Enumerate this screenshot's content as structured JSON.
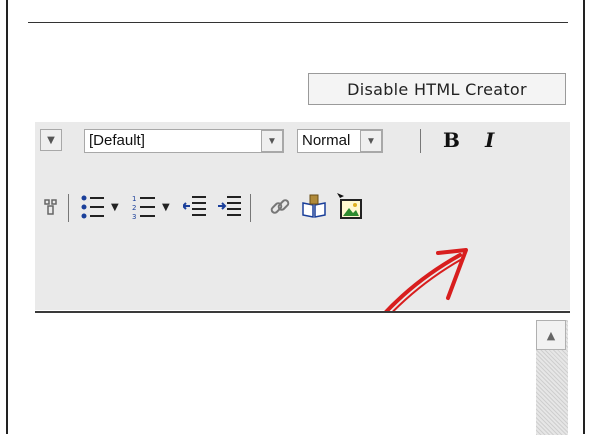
{
  "header": {
    "disable_label": "Disable HTML Creator"
  },
  "toolbar": {
    "font_name_select": {
      "value": "[Default]"
    },
    "format_select": {
      "value": "Normal"
    },
    "bold_label": "B",
    "italic_label": "I"
  },
  "icons": {
    "bullet_list": "bullet-list-icon",
    "numbered_list": "numbered-list-icon",
    "outdent": "outdent-icon",
    "indent": "indent-icon",
    "link": "link-icon",
    "anchor": "anchor-icon",
    "image": "insert-image-icon"
  },
  "colors": {
    "annotation_arrow": "#d81e1e",
    "toolbar_bg": "#eaeaea"
  }
}
